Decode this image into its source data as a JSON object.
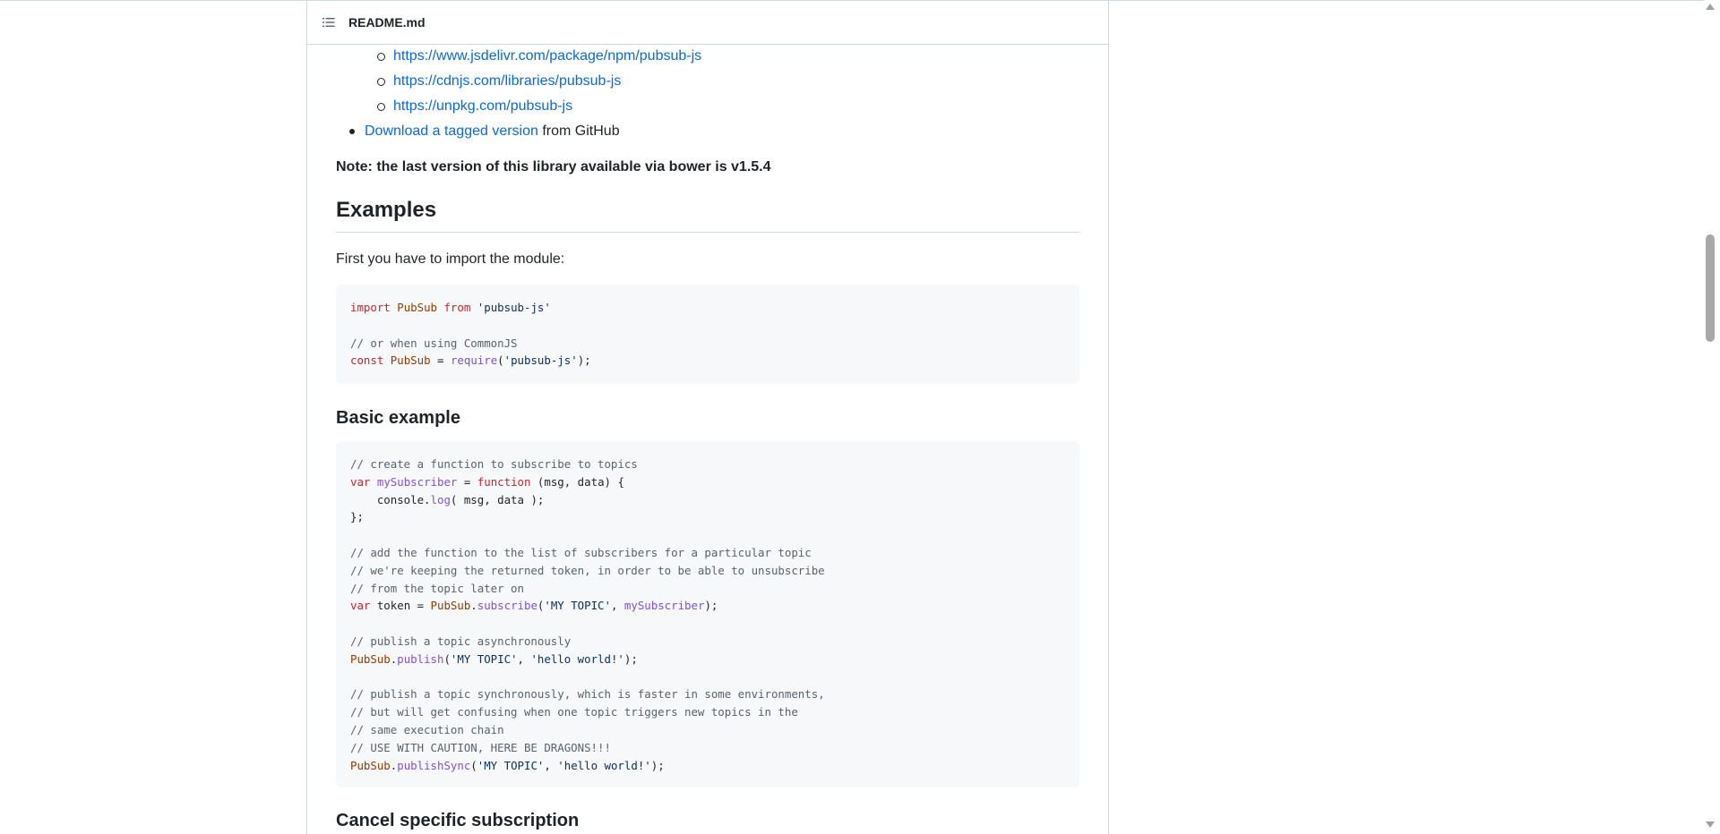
{
  "header": {
    "title": "README.md",
    "toc_icon": "list-unordered-icon"
  },
  "cdn_links": [
    "https://www.jsdelivr.com/package/npm/pubsub-js",
    "https://cdnjs.com/libraries/pubsub-js",
    "https://unpkg.com/pubsub-js"
  ],
  "download": {
    "link_text": "Download a tagged version",
    "suffix": " from GitHub"
  },
  "note": "Note: the last version of this library available via bower is v1.5.4",
  "examples": {
    "heading": "Examples",
    "intro": "First you have to import the module:",
    "code1": [
      "import PubSub from 'pubsub-js'",
      "",
      "// or when using CommonJS",
      "const PubSub = require('pubsub-js');"
    ]
  },
  "basic": {
    "heading": "Basic example",
    "code": [
      "// create a function to subscribe to topics",
      "var mySubscriber = function (msg, data) {",
      "    console.log( msg, data );",
      "};",
      "",
      "// add the function to the list of subscribers for a particular topic",
      "// we're keeping the returned token, in order to be able to unsubscribe",
      "// from the topic later on",
      "var token = PubSub.subscribe('MY TOPIC', mySubscriber);",
      "",
      "// publish a topic asynchronously",
      "PubSub.publish('MY TOPIC', 'hello world!');",
      "",
      "// publish a topic synchronously, which is faster in some environments,",
      "// but will get confusing when one topic triggers new topics in the",
      "// same execution chain",
      "// USE WITH CAUTION, HERE BE DRAGONS!!!",
      "PubSub.publishSync('MY TOPIC', 'hello world!');"
    ]
  },
  "cancel": {
    "heading": "Cancel specific subscription"
  }
}
